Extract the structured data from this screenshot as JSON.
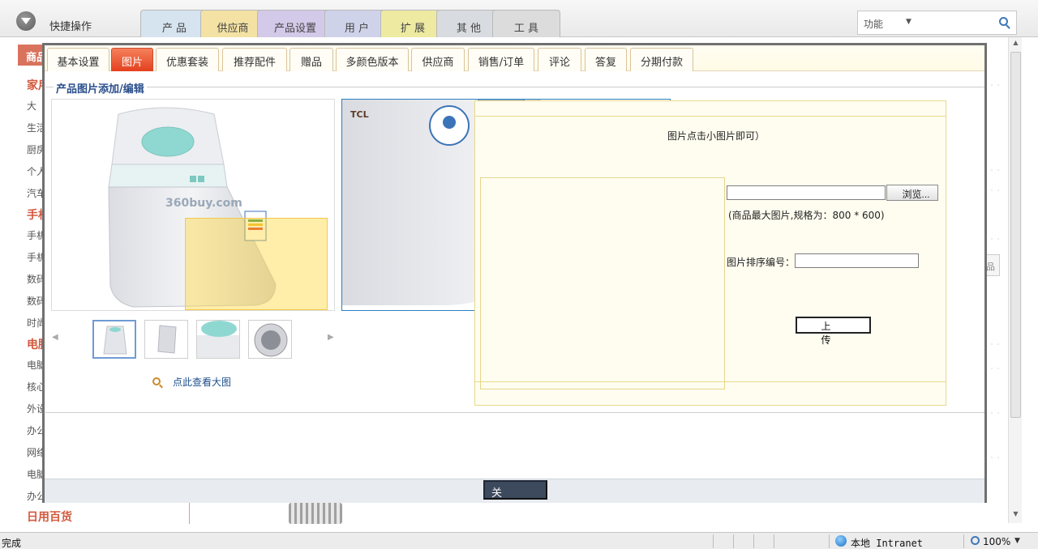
{
  "quick_ops": {
    "label": "快捷操作"
  },
  "nav_tabs": [
    {
      "label": "产 品",
      "color": "#d6e4f0"
    },
    {
      "label": "供应商",
      "color": "#f3e2a4"
    },
    {
      "label": "产品设置",
      "color": "#d3c9e8"
    },
    {
      "label": "用 户",
      "color": "#cfd3ea"
    },
    {
      "label": "扩 展",
      "color": "#eeeaa1"
    },
    {
      "label": "其 他",
      "color": "#d8dbe0"
    },
    {
      "label": "工 具",
      "color": "#dcdcdc"
    }
  ],
  "search": {
    "label": "功能",
    "dropdown": "▼"
  },
  "background_sidebar": {
    "header": "商品",
    "items": [
      "家用",
      "大",
      "生活",
      "厨房",
      "个人",
      "汽车",
      "手机",
      "手机",
      "手机",
      "数码",
      "数码",
      "时尚",
      "电脑",
      "电脑",
      "核心",
      "外设",
      "办公",
      "网络",
      "电脑",
      "办公",
      "日用百货"
    ],
    "categories_red": [
      0,
      6,
      12,
      20
    ]
  },
  "background_misc": {
    "corner_button": "品"
  },
  "dialog": {
    "tabs": [
      "基本设置",
      "图片",
      "优惠套装",
      "推荐配件",
      "赠品",
      "多颜色版本",
      "供应商",
      "销售/订单",
      "评论",
      "答复",
      "分期付款"
    ],
    "active_tab": 1,
    "group_title": "产品图片添加/编辑",
    "view_big_link": "点此查看大图",
    "upload_hint": "图片点击小图片即可）",
    "browse_button": "浏览...",
    "file_value": "",
    "size_note": "(商品最大图片,规格为：800 * 600)",
    "sort_label": "图片排序编号：",
    "sort_value": "",
    "upload_button": "上传",
    "close_button": "关闭",
    "watermark_logo": "360buy.com",
    "brand_logo": "TCL"
  },
  "statusbar": {
    "status": "完成",
    "zone": "本地 Intranet",
    "zoom": "100%",
    "zoom_dropdown": "▼"
  },
  "colors": {
    "accent_red": "#e4401e",
    "lens_yellow": "#ffd642",
    "zoom_border": "#2c7fc0",
    "upload_bg": "#fffdf0"
  }
}
